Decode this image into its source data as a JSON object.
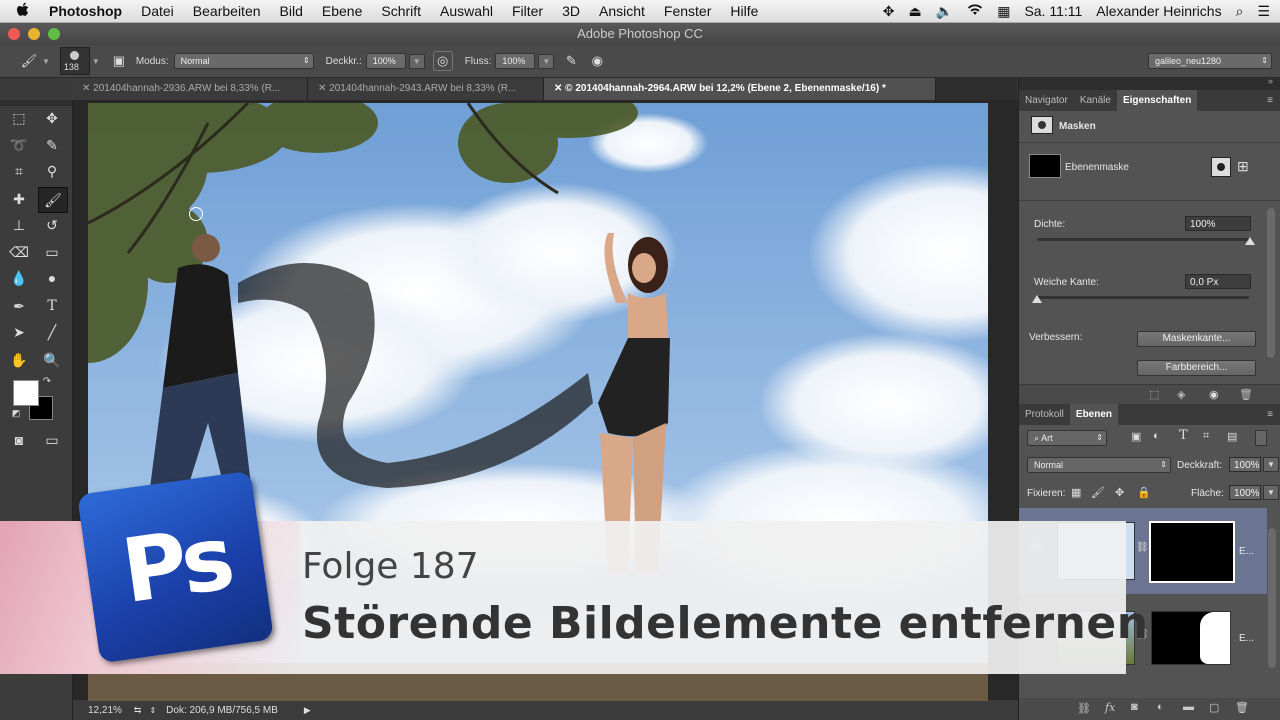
{
  "menubar": {
    "apple": "",
    "app": "Photoshop",
    "items": [
      "Datei",
      "Bearbeiten",
      "Bild",
      "Ebene",
      "Schrift",
      "Auswahl",
      "Filter",
      "3D",
      "Ansicht",
      "Fenster",
      "Hilfe"
    ],
    "clock": "Sa. 11:11",
    "user": "Alexander Heinrichs"
  },
  "window": {
    "title": "Adobe Photoshop CC"
  },
  "options": {
    "brush_size": "138",
    "mode_label": "Modus:",
    "mode_value": "Normal",
    "opacity_label": "Deckkr.:",
    "opacity_value": "100%",
    "flow_label": "Fluss:",
    "flow_value": "100%",
    "workspace": "galileo_neu1280"
  },
  "tabs": [
    {
      "label": "201404hannah-2936.ARW bei 8,33% (R..."
    },
    {
      "label": "201404hannah-2943.ARW bei 8,33% (R..."
    },
    {
      "label": "© 201404hannah-2964.ARW bei 12,2% (Ebene 2, Ebenenmaske/16) *"
    }
  ],
  "status": {
    "zoom": "12,21%",
    "doc": "Dok: 206,9 MB/756,5 MB"
  },
  "properties": {
    "tabs": [
      "Navigator",
      "Kanäle",
      "Eigenschaften"
    ],
    "section": "Masken",
    "mask_name": "Ebenenmaske",
    "density_label": "Dichte:",
    "density_value": "100%",
    "feather_label": "Weiche Kante:",
    "feather_value": "0,0 Px",
    "refine_label": "Verbessern:",
    "refine_edge_btn": "Maskenkante...",
    "color_range_btn": "Farbbereich..."
  },
  "layers": {
    "tabs": [
      "Protokoll",
      "Ebenen"
    ],
    "filter_value": "Art",
    "blend_value": "Normal",
    "opacity_label": "Deckkraft:",
    "opacity_value": "100%",
    "lock_label": "Fixieren:",
    "fill_label": "Fläche:",
    "fill_value": "100%",
    "layer_suffix": "E..."
  },
  "banner": {
    "logo": "Ps",
    "episode": "Folge 187",
    "title": "Störende Bildelemente entfernen"
  },
  "colors": {
    "sky_top": "#6f9fd6",
    "sky_bottom": "#b9d2ee",
    "logo_blue": "#1a3fa8"
  }
}
